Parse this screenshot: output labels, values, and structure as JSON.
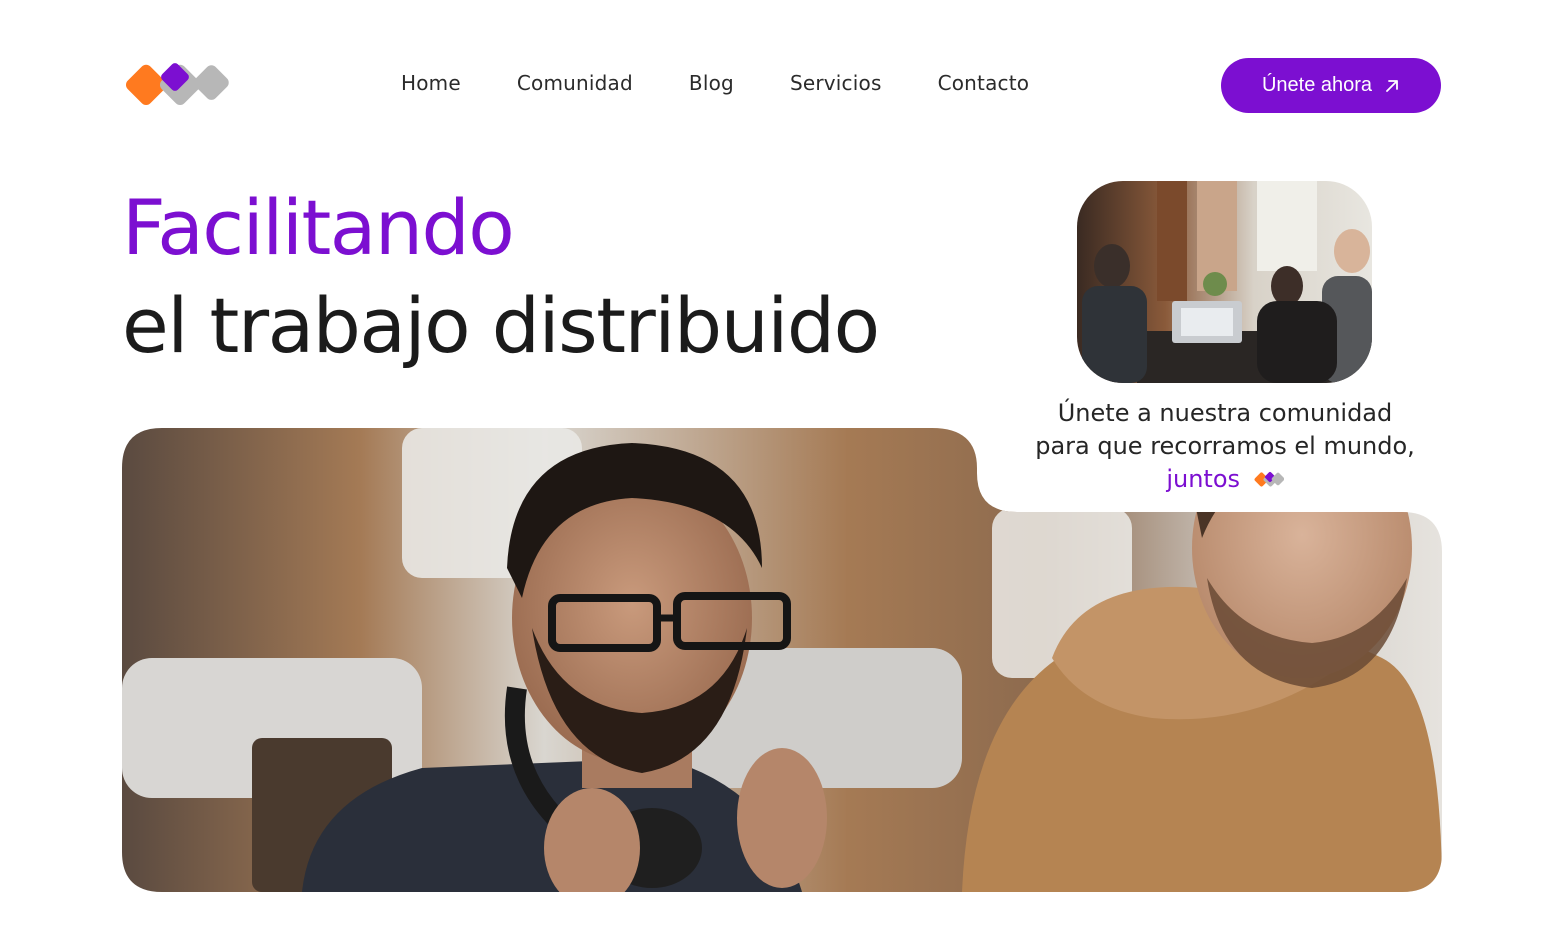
{
  "brand": {
    "logo_icon": "three-diamond-logo",
    "colors": {
      "orange": "#ff7a1f",
      "purple": "#7c0fd1",
      "gray": "#b7b7b7"
    }
  },
  "nav": {
    "items": [
      {
        "label": "Home"
      },
      {
        "label": "Comunidad"
      },
      {
        "label": "Blog"
      },
      {
        "label": "Servicios"
      },
      {
        "label": "Contacto"
      }
    ]
  },
  "cta": {
    "label": "Únete ahora",
    "icon": "arrow-up-right-icon"
  },
  "hero": {
    "title_line1": "Facilitando",
    "title_line2": "el trabajo distribuido"
  },
  "tagline": {
    "line1": "Únete a nuestra comunidad",
    "line2": "para que recorramos el mundo,",
    "accent": "juntos"
  },
  "accent_color": "#7c0fd1"
}
